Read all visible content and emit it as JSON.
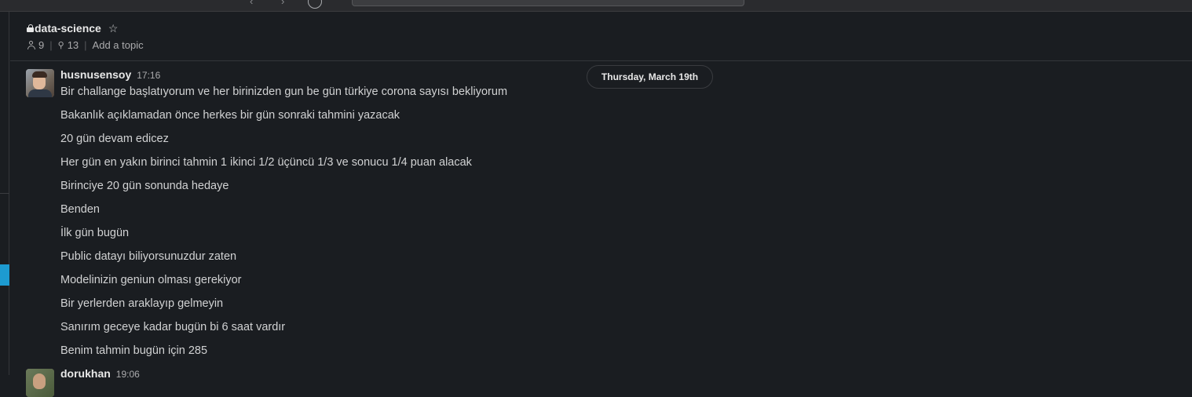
{
  "channel": {
    "name": "data-science",
    "members_count": "9",
    "pins_count": "13",
    "topic_placeholder": "Add a topic"
  },
  "date_divider": "Thursday, March 19th",
  "messages": [
    {
      "author": "husnusensoy",
      "time": "17:16",
      "lines": [
        "Bir challange başlatıyorum ve her birinizden gun be gün türkiye corona sayısı bekliyorum",
        "Bakanlık açıklamadan önce herkes bir gün sonraki tahmini yazacak",
        "20 gün devam edicez",
        "Her gün en yakın birinci tahmin 1 ikinci 1/2 üçüncü 1/3 ve sonucu 1/4 puan alacak",
        "Birinciye 20 gün sonunda hedaye",
        "Benden",
        "İlk gün bugün",
        "Public datayı biliyorsunuzdur zaten",
        "Modelinizin geniun olması gerekiyor",
        "Bir yerlerden araklayıp gelmeyin",
        "Sanırım geceye kadar bugün bi 6 saat vardır",
        "Benim tahmin bugün için 285"
      ]
    },
    {
      "author": "dorukhan",
      "time": "19:06",
      "lines": []
    }
  ],
  "colors": {
    "background": "#1a1d21",
    "accent": "#1d9bd1",
    "text": "#d1d2d3"
  }
}
